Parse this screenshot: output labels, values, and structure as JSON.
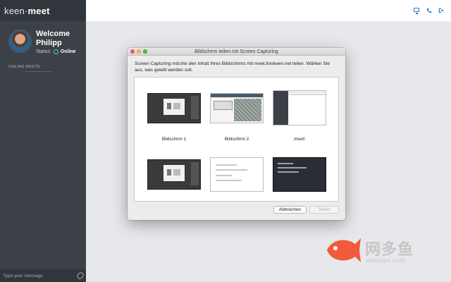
{
  "app": {
    "brand_light": "keen",
    "brand_bold": "meet"
  },
  "profile": {
    "welcome": "Welcome",
    "name": "Philipp",
    "status_label": "Status:",
    "status_value": "Online"
  },
  "sidebar": {
    "section_title": "ONLINE MEETS"
  },
  "message": {
    "placeholder": "Type your message"
  },
  "topbar": {
    "icons": [
      "monitor-icon",
      "phone-icon",
      "exit-icon"
    ],
    "accent": "#2c7cc6"
  },
  "dialog": {
    "title": "Bildschirm teilen mit Screen Capturing",
    "text": "Screen Capturing möchte den Inhalt Ihres Bildschirms mit meet.lionkeen.net teilen. Wählen Sie aus, was geteilt werden soll.",
    "sources": [
      {
        "label": "Bildschirm 1"
      },
      {
        "label": "Bildschirm 2"
      },
      {
        "label": "meet!"
      },
      {
        "label": ""
      },
      {
        "label": ""
      },
      {
        "label": ""
      }
    ],
    "cancel_label": "Abbrechen",
    "share_label": "Teilen"
  },
  "watermark": {
    "title": "网多鱼",
    "url": "wduoyu.com"
  }
}
